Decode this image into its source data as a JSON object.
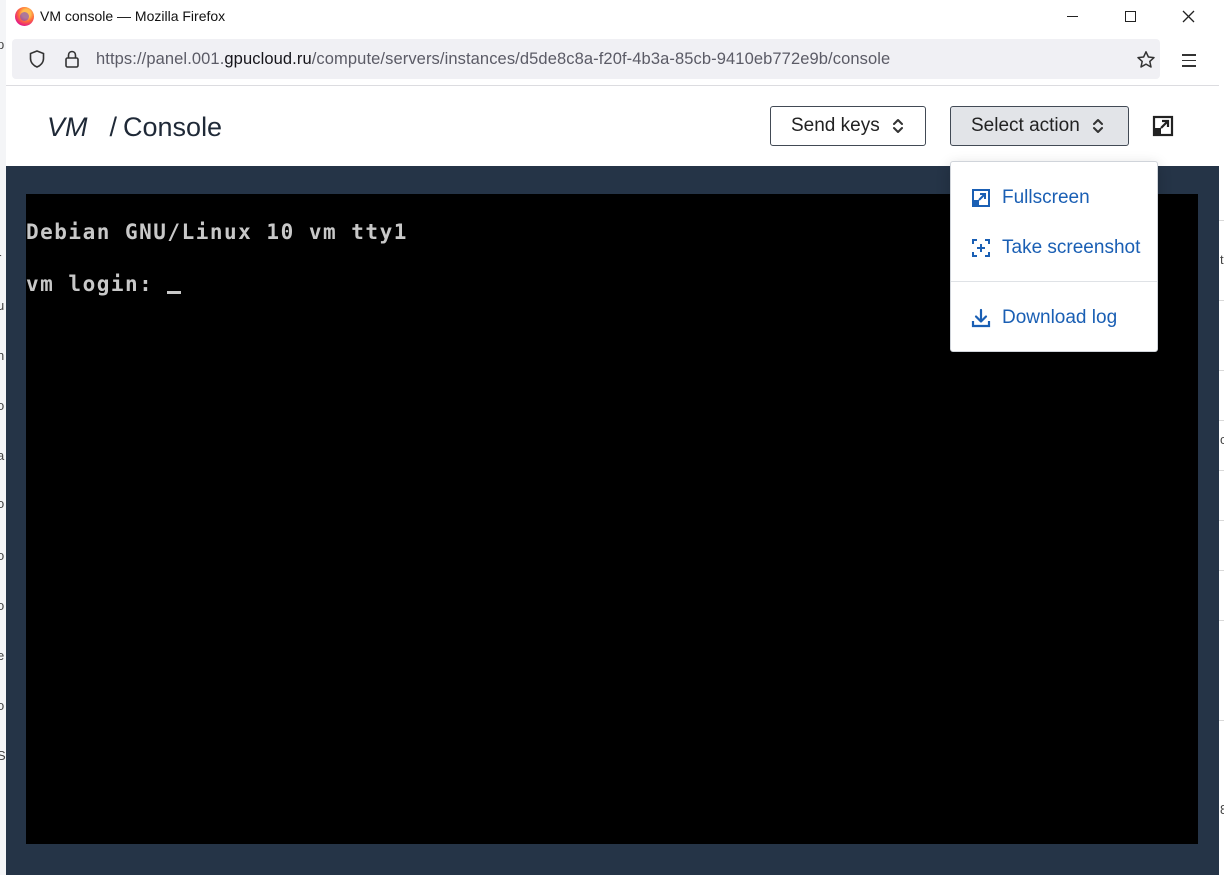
{
  "window": {
    "title": "VM console — Mozilla Firefox"
  },
  "address_bar": {
    "url_prefix": "https://panel.001.",
    "url_host": "gpucloud.ru",
    "url_path": "/compute/servers/instances/d5de8c8a-f20f-4b3a-85cb-9410eb772e9b/console"
  },
  "header": {
    "breadcrumb_root": "VM",
    "breadcrumb_sep": "/",
    "breadcrumb_current": "Console",
    "send_keys_label": "Send keys",
    "select_action_label": "Select action"
  },
  "console": {
    "line1": "Debian GNU/Linux 10 vm tty1",
    "line2": "vm login: "
  },
  "action_menu": {
    "fullscreen": "Fullscreen",
    "screenshot": "Take screenshot",
    "download_log": "Download log"
  },
  "background_fragments": {
    "left": [
      "p",
      "r",
      "u",
      "n",
      "o",
      "a",
      "o",
      "o",
      "o",
      "e",
      "o",
      "S"
    ],
    "right": [
      "t",
      "c",
      "8"
    ]
  },
  "colors": {
    "console_frame": "#253447",
    "menu_link": "#1a5fb4",
    "terminal_text": "#c8c8c8"
  }
}
